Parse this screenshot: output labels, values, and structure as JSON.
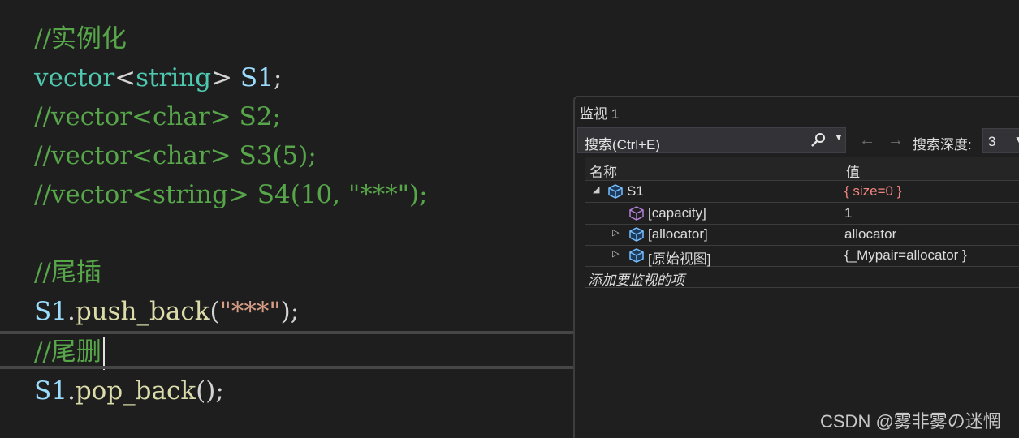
{
  "editor": {
    "l1": {
      "comment": "//实例化"
    },
    "l2": {
      "type": "vector",
      "lt": "<",
      "arg": "string",
      "gt": ">",
      "var": " S1",
      "semi": ";"
    },
    "l3": {
      "comment": "//vector<char> S2;"
    },
    "l4": {
      "comment": "//vector<char> S3(5);"
    },
    "l5": {
      "comment": "//vector<string> S4(10, \"***\");"
    },
    "l6": {
      "comment": "//尾插"
    },
    "l7": {
      "obj": "S1",
      "dot": ".",
      "fn": "push_back",
      "open": "(",
      "str": "\"***\"",
      "close": ");"
    },
    "l8": {
      "comment": "//尾删"
    },
    "l9": {
      "obj": "S1",
      "dot": ".",
      "fn": "pop_back",
      "call": "();"
    }
  },
  "watch": {
    "title": "监视 1",
    "search_placeholder": "搜索(Ctrl+E)",
    "search_icon": "search-icon",
    "depth_label": "搜索深度:",
    "depth_value": "3",
    "columns": {
      "name": "名称",
      "value": "值"
    },
    "rows": [
      {
        "name": "S1",
        "value": "{ size=0 }",
        "icon": "object-icon",
        "expanded": true
      },
      {
        "name": "[capacity]",
        "value": "1",
        "icon": "property-icon"
      },
      {
        "name": "[allocator]",
        "value": "allocator",
        "icon": "object-icon",
        "expanded": false
      },
      {
        "name": "[原始视图]",
        "value": "{_Mypair=allocator }",
        "icon": "object-icon",
        "expanded": false
      }
    ],
    "add_watch": "添加要监视的项"
  },
  "colors": {
    "comment": "#57a64a",
    "type": "#4ec9b0",
    "variable": "#9cdcfe",
    "function": "#dcdcaa",
    "string": "#d69d85",
    "changed_value": "#f0857d"
  },
  "watermark": "CSDN @雾非雾の迷惘"
}
